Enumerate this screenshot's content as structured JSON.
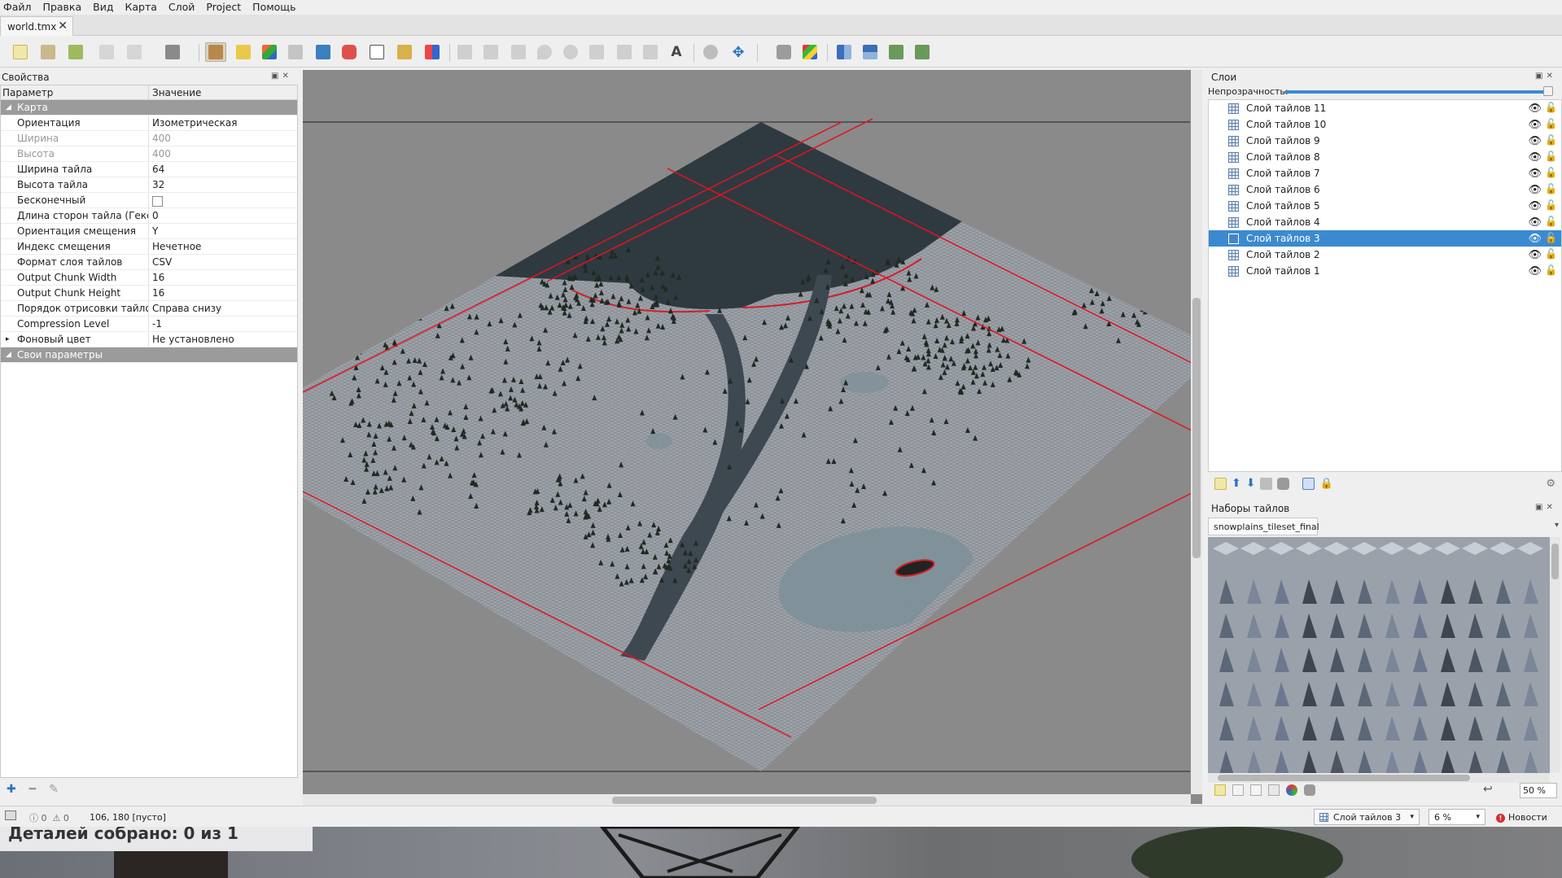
{
  "menu": [
    "Файл",
    "Правка",
    "Вид",
    "Карта",
    "Слой",
    "Project",
    "Помощь"
  ],
  "document_tab": {
    "name": "world.tmx",
    "close": "✕"
  },
  "properties": {
    "title": "Свойства",
    "col_param": "Параметр",
    "col_value": "Значение",
    "group_map": "Карта",
    "rows": [
      {
        "key": "Ориентация",
        "value": "Изометрическая",
        "disabled": false
      },
      {
        "key": "Ширина",
        "value": "400",
        "disabled": true
      },
      {
        "key": "Высота",
        "value": "400",
        "disabled": true
      },
      {
        "key": "Ширина тайла",
        "value": "64",
        "disabled": false
      },
      {
        "key": "Высота тайла",
        "value": "32",
        "disabled": false
      },
      {
        "key": "Бесконечный",
        "value": "",
        "checkbox": true,
        "disabled": false
      },
      {
        "key": "Длина сторон тайла (Гекс)",
        "value": "0",
        "disabled": false
      },
      {
        "key": "Ориентация смещения",
        "value": "Y",
        "disabled": false
      },
      {
        "key": "Индекс смещения",
        "value": "Нечетное",
        "disabled": false
      },
      {
        "key": "Формат слоя тайлов",
        "value": "CSV",
        "disabled": false
      },
      {
        "key": "Output Chunk Width",
        "value": "16",
        "disabled": false
      },
      {
        "key": "Output Chunk Height",
        "value": "16",
        "disabled": false
      },
      {
        "key": "Порядок отрисовки тайлов",
        "value": "Справа снизу",
        "disabled": false
      },
      {
        "key": "Compression Level",
        "value": "-1",
        "disabled": false
      },
      {
        "key": "Фоновый цвет",
        "value": "Не установлено",
        "disabled": false
      }
    ],
    "group_custom": "Свои параметры"
  },
  "layers": {
    "title": "Слои",
    "opacity_label": "Непрозрачность:",
    "items": [
      "Слой тайлов 11",
      "Слой тайлов 10",
      "Слой тайлов 9",
      "Слой тайлов 8",
      "Слой тайлов 7",
      "Слой тайлов 6",
      "Слой тайлов 5",
      "Слой тайлов 4",
      "Слой тайлов 3",
      "Слой тайлов 2",
      "Слой тайлов 1"
    ],
    "selected": "Слой тайлов 3"
  },
  "tilesets": {
    "title": "Наборы тайлов",
    "tab": "snowplains_tileset_final",
    "zoom": "50 %"
  },
  "status": {
    "warnings": "0",
    "errors": "0",
    "coords": "106, 180 [пусто]",
    "current_layer": "Слой тайлов 3",
    "zoom": "6 %",
    "news": "Новости"
  },
  "background_game": {
    "text": "Деталей собрано: 0 из 1"
  },
  "colors": {
    "accent": "#3b8ad0",
    "grid_line": "#e0141e",
    "water": "#2f3940",
    "snow": "#9ea3aa"
  }
}
